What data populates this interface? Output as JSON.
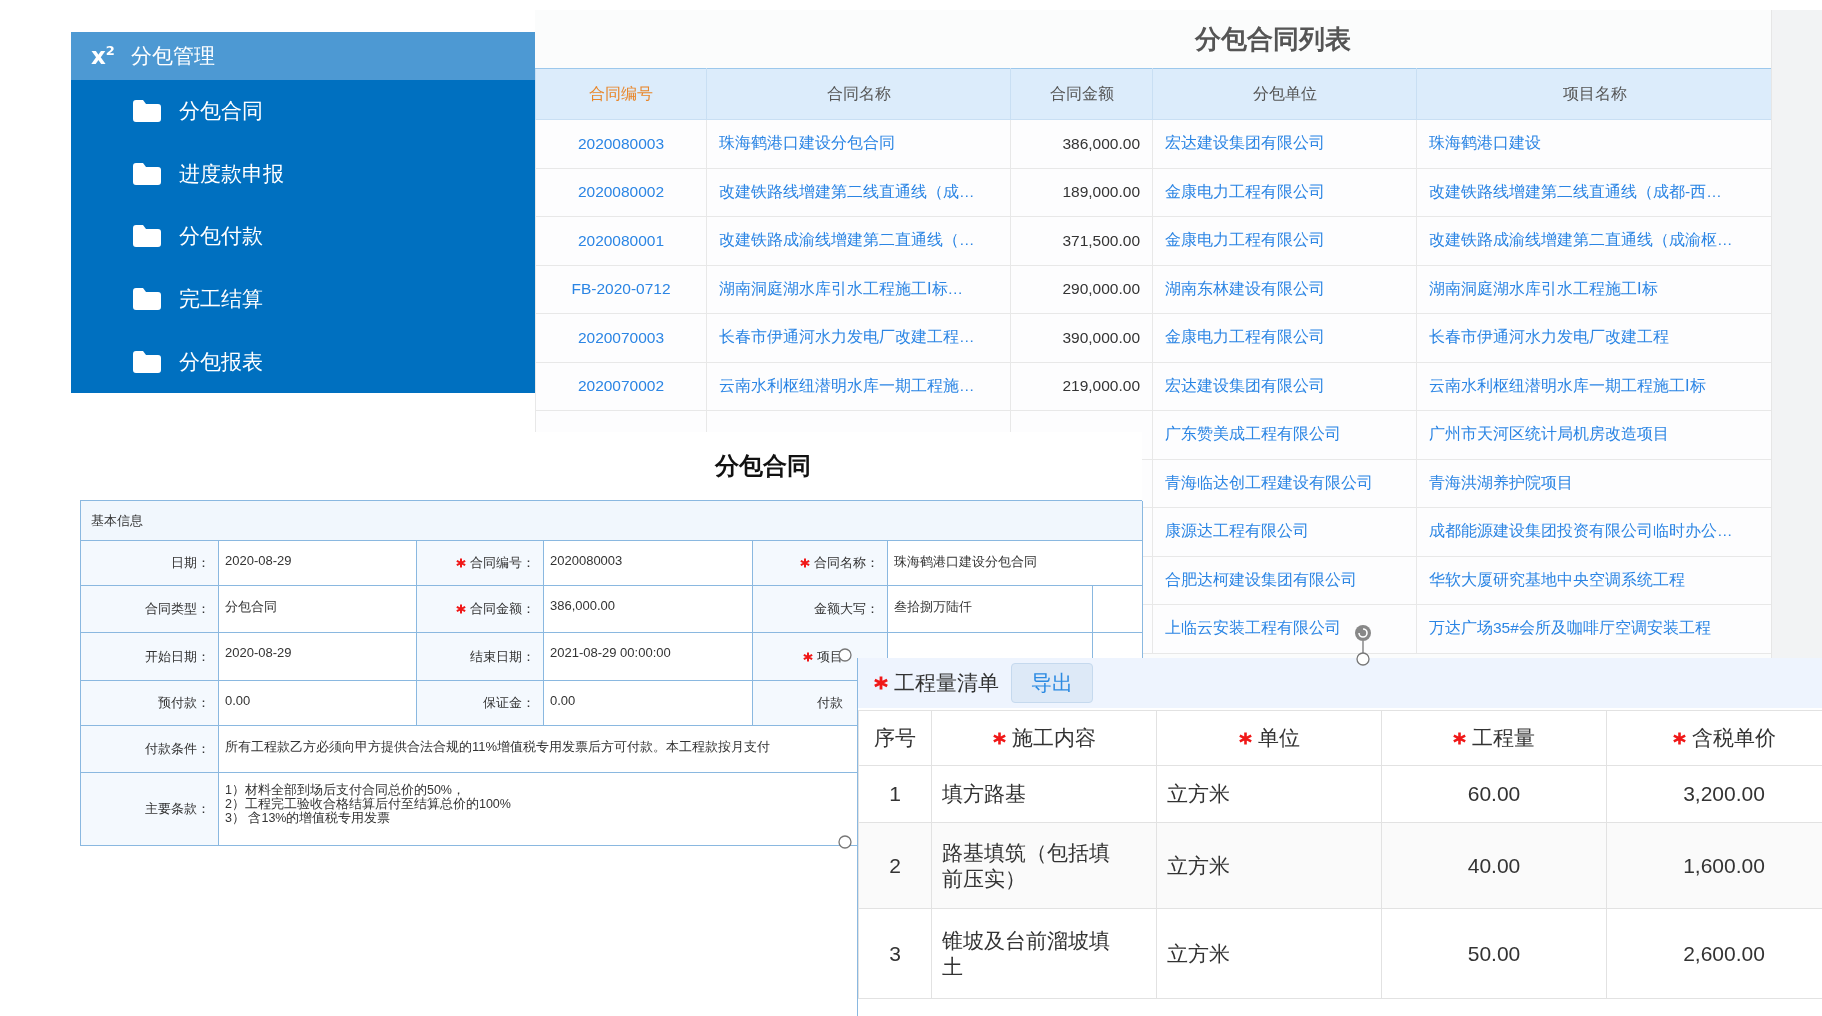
{
  "sidebar": {
    "icon_text": "x$^{2}$",
    "title": "分包管理",
    "items": [
      {
        "label": "分包合同"
      },
      {
        "label": "进度款申报"
      },
      {
        "label": "分包付款"
      },
      {
        "label": "完工结算"
      },
      {
        "label": "分包报表"
      }
    ]
  },
  "contract_list": {
    "title": "分包合同列表",
    "columns": [
      {
        "label": "合同编号",
        "sorted": true
      },
      {
        "label": "合同名称",
        "sorted": false
      },
      {
        "label": "合同金额",
        "sorted": false
      },
      {
        "label": "分包单位",
        "sorted": false
      },
      {
        "label": "项目名称",
        "sorted": false
      }
    ],
    "rows": [
      {
        "contract_no": "2020080003",
        "contract_name": "珠海鹤港口建设分包合同",
        "amount": "386,000.00",
        "subcontractor": "宏达建设集团有限公司",
        "project": "珠海鹤港口建设"
      },
      {
        "contract_no": "2020080002",
        "contract_name": "改建铁路线增建第二线直通线（成…",
        "amount": "189,000.00",
        "subcontractor": "金康电力工程有限公司",
        "project": "改建铁路线增建第二线直通线（成都-西…"
      },
      {
        "contract_no": "2020080001",
        "contract_name": "改建铁路成渝线增建第二直通线（…",
        "amount": "371,500.00",
        "subcontractor": "金康电力工程有限公司",
        "project": "改建铁路成渝线增建第二直通线（成渝枢…"
      },
      {
        "contract_no": "FB-2020-0712",
        "contract_name": "湖南洞庭湖水库引水工程施工Ⅰ标…",
        "amount": "290,000.00",
        "subcontractor": "湖南东林建设有限公司",
        "project": "湖南洞庭湖水库引水工程施工Ⅰ标"
      },
      {
        "contract_no": "2020070003",
        "contract_name": "长春市伊通河水力发电厂改建工程…",
        "amount": "390,000.00",
        "subcontractor": "金康电力工程有限公司",
        "project": "长春市伊通河水力发电厂改建工程"
      },
      {
        "contract_no": "2020070002",
        "contract_name": "云南水利枢纽潜明水库一期工程施…",
        "amount": "219,000.00",
        "subcontractor": "宏达建设集团有限公司",
        "project": "云南水利枢纽潜明水库一期工程施工Ⅰ标"
      },
      {
        "subcontractor": "广东赞美成工程有限公司",
        "project": "广州市天河区统计局机房改造项目"
      },
      {
        "subcontractor": "青海临达创工程建设有限公司",
        "project": "青海洪湖养护院项目"
      },
      {
        "subcontractor": "康源达工程有限公司",
        "project": "成都能源建设集团投资有限公司临时办公…"
      },
      {
        "subcontractor": "合肥达柯建设集团有限公司",
        "project": "华软大厦研究基地中央空调系统工程"
      },
      {
        "subcontractor": "上临云安装工程有限公司",
        "project": "万达广场35#会所及咖啡厅空调安装工程"
      }
    ]
  },
  "contract_form": {
    "title": "分包合同",
    "section": "基本信息",
    "rows": [
      [
        {
          "label": "日期：",
          "required": false,
          "value": "2020-08-29"
        },
        {
          "label": "合同编号：",
          "required": true,
          "value": "2020080003"
        },
        {
          "label": "合同名称：",
          "required": true,
          "value": "珠海鹤港口建设分包合同"
        }
      ],
      [
        {
          "label": "合同类型：",
          "required": false,
          "value": "分包合同"
        },
        {
          "label": "合同金额：",
          "required": true,
          "value": "386,000.00"
        },
        {
          "label": "金额大写：",
          "required": false,
          "value": "叁拾捌万陆仟"
        }
      ],
      [
        {
          "label": "开始日期：",
          "required": false,
          "value": "2020-08-29"
        },
        {
          "label": "结束日期：",
          "required": false,
          "value": "2021-08-29 00:00:00"
        },
        {
          "label": "项目",
          "required": true
        }
      ],
      [
        {
          "label": "预付款：",
          "required": false,
          "value": "0.00"
        },
        {
          "label": "保证金：",
          "required": false,
          "value": "0.00"
        },
        {
          "label": "付款",
          "required": false
        }
      ],
      [
        {
          "label": "付款条件：",
          "required": false,
          "value": "所有工程款乙方必须向甲方提供合法合规的11%增值税专用发票后方可付款。本工程款按月支付"
        }
      ],
      [
        {
          "label": "主要条款：",
          "required": false,
          "lines": [
            "1）材料全部到场后支付合同总价的50%，",
            "2）工程完工验收合格结算后付至结算总价的100%",
            "3） 含13%的增值税专用发票"
          ]
        }
      ]
    ]
  },
  "quantity_list": {
    "title": "工程量清单",
    "required": true,
    "export_button": "导出",
    "columns": [
      {
        "label": "序号",
        "required": false
      },
      {
        "label": "施工内容",
        "required": true
      },
      {
        "label": "单位",
        "required": true
      },
      {
        "label": "工程量",
        "required": true
      },
      {
        "label": "含税单价",
        "required": true
      }
    ],
    "rows": [
      [
        "1",
        "填方路基",
        "立方米",
        "60.00",
        "3,200.00"
      ],
      [
        "2",
        "路基填筑（包括填前压实）",
        "立方米",
        "40.00",
        "1,600.00"
      ],
      [
        "3",
        "锥坡及台前溜坡填土",
        "立方米",
        "50.00",
        "2,600.00"
      ]
    ]
  }
}
